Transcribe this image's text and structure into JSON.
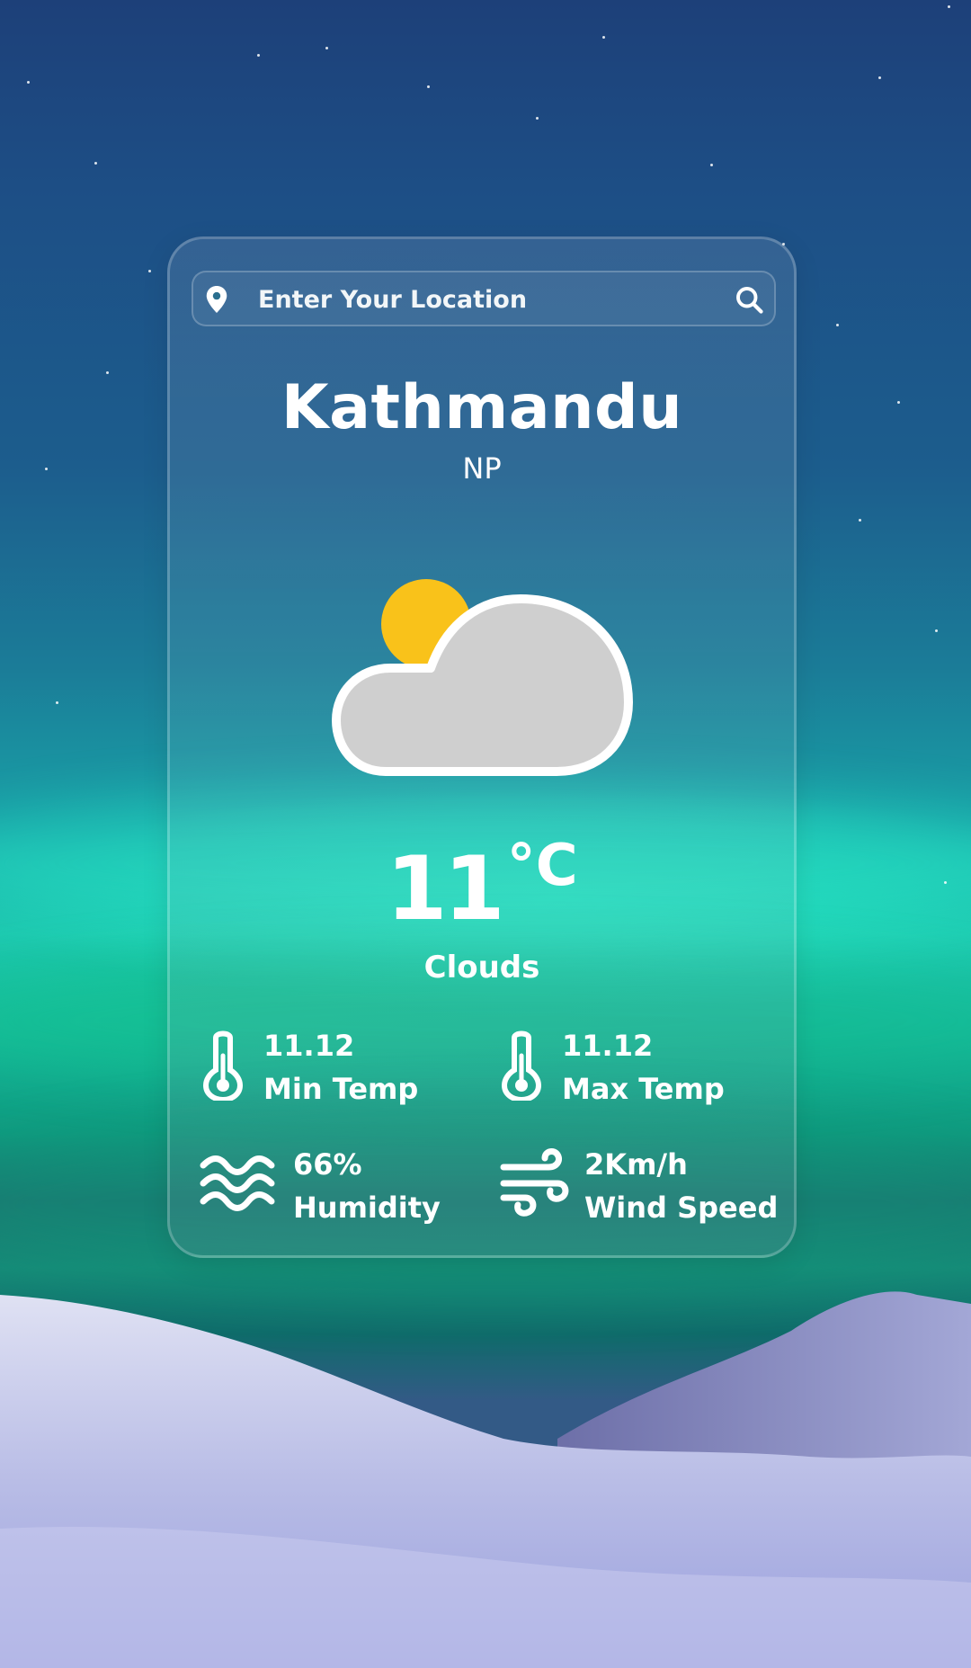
{
  "search": {
    "placeholder": "Enter Your Location",
    "location_icon": "location-pin-icon",
    "search_icon": "search-icon"
  },
  "weather": {
    "city": "Kathmandu",
    "country": "NP",
    "temperature": "11",
    "unit": "°C",
    "condition": "Clouds",
    "icon": "partly-cloudy-icon"
  },
  "stats": {
    "min_temp": {
      "value": "11.12",
      "label": "Min Temp",
      "icon": "thermometer-icon"
    },
    "max_temp": {
      "value": "11.12",
      "label": "Max Temp",
      "icon": "thermometer-icon"
    },
    "humidity": {
      "value": "66%",
      "label": "Humidity",
      "icon": "waves-icon"
    },
    "wind": {
      "value": "2Km/h",
      "label": "Wind Speed",
      "icon": "wind-icon"
    }
  },
  "colors": {
    "sun": "#f9c21a",
    "cloud": "#cfcfcf",
    "text": "#ffffff"
  }
}
